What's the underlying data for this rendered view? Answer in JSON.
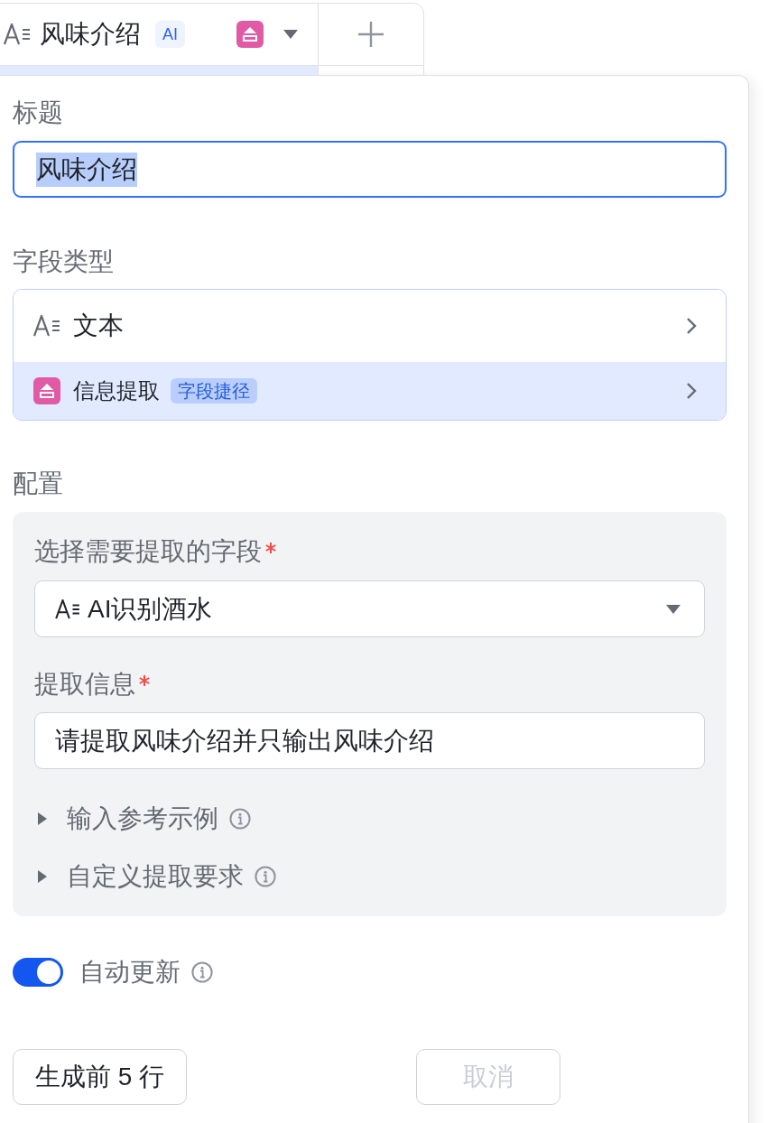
{
  "column_header": {
    "title": "风味介绍",
    "badge": "AI",
    "selected": true
  },
  "form": {
    "title_field": {
      "label": "标题",
      "value": "风味介绍",
      "value_selected": true
    },
    "field_type": {
      "label": "字段类型",
      "options": [
        {
          "kind": "text",
          "label": "文本",
          "selected": false
        },
        {
          "kind": "extract",
          "label": "信息提取",
          "tag": "字段捷径",
          "selected": true
        }
      ]
    },
    "config": {
      "label": "配置",
      "source_field": {
        "label": "选择需要提取的字段",
        "required": true,
        "value": "AI识别酒水"
      },
      "extract_info": {
        "label": "提取信息",
        "required": true,
        "value": "请提取风味介绍并只输出风味介绍"
      },
      "sections": [
        {
          "label": "输入参考示例",
          "expanded": false
        },
        {
          "label": "自定义提取要求",
          "expanded": false
        }
      ]
    },
    "auto_update": {
      "label": "自动更新",
      "on": true
    },
    "buttons": [
      {
        "label": "生成前 5 行",
        "disabled": false
      },
      {
        "label": "取消",
        "disabled": true
      }
    ]
  }
}
